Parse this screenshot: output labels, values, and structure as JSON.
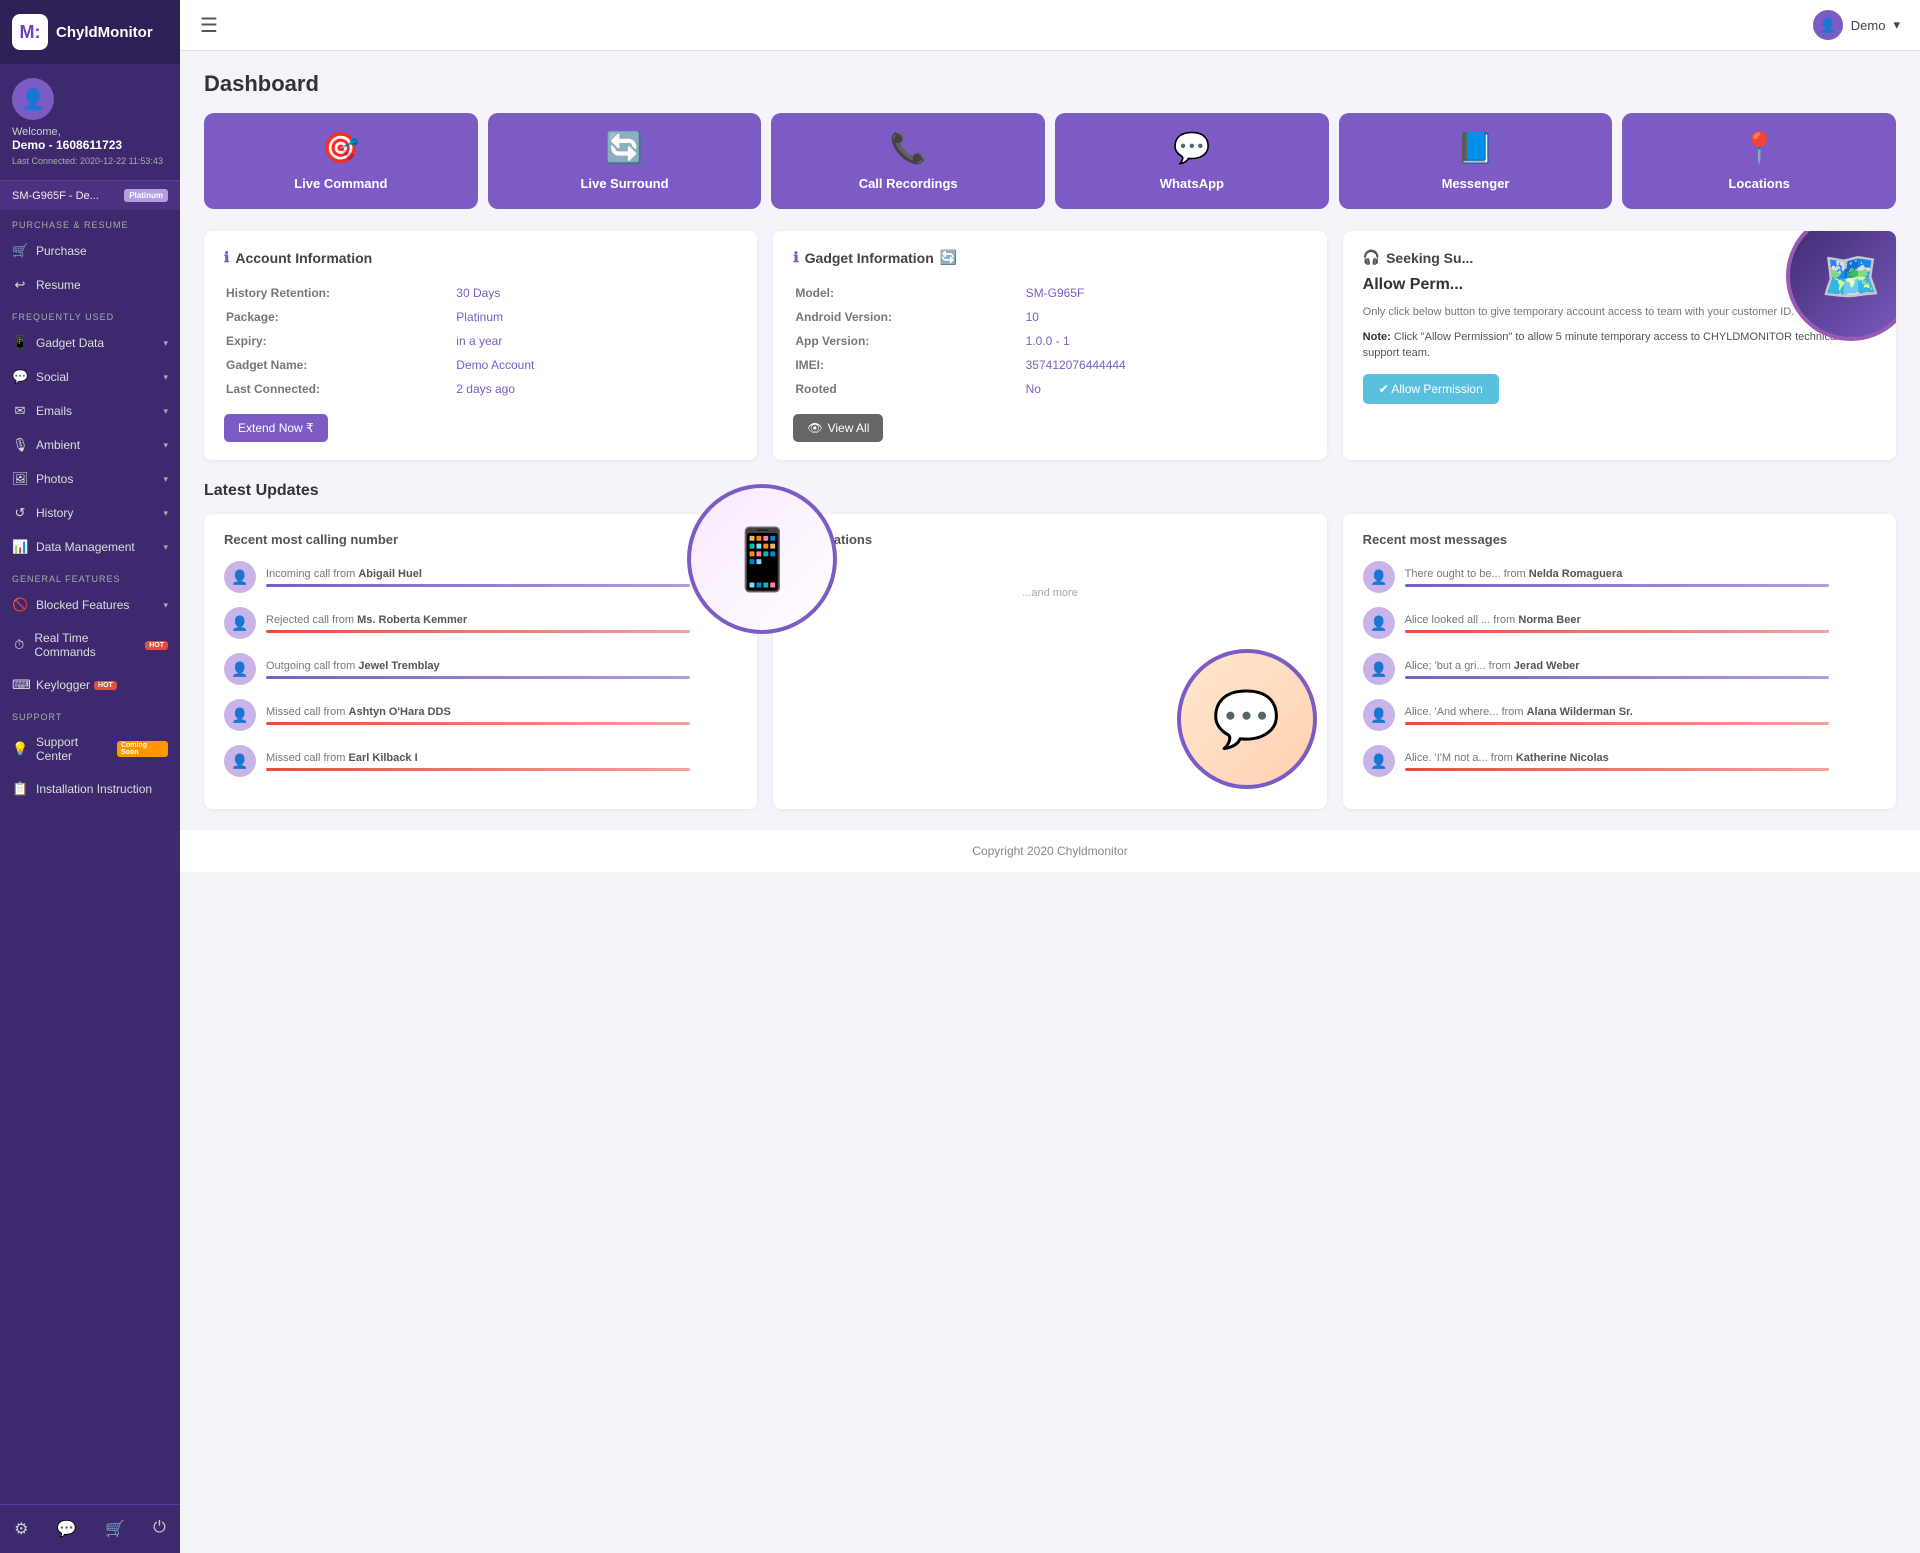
{
  "app": {
    "name": "ChyldMonitor",
    "logo_letter": "M:"
  },
  "topbar": {
    "menu_icon": "☰",
    "user_label": "Demo",
    "user_dropdown": "▾"
  },
  "sidebar": {
    "user": {
      "welcome": "Welcome,",
      "name": "Demo - 1608611723",
      "last_connected": "Last Connected: 2020-12-22 11:53:43"
    },
    "device": {
      "name": "SM-G965F - De...",
      "badge": "Platinum"
    },
    "sections": [
      {
        "title": "PURCHASE & RESUME",
        "items": [
          {
            "label": "Purchase",
            "icon": "🛒"
          },
          {
            "label": "Resume",
            "icon": "↩"
          }
        ]
      },
      {
        "title": "FREQUENTLY USED",
        "items": [
          {
            "label": "Gadget Data",
            "icon": "📱",
            "has_arrow": true
          },
          {
            "label": "Social",
            "icon": "💬",
            "has_arrow": true
          },
          {
            "label": "Emails",
            "icon": "✉",
            "has_arrow": true
          },
          {
            "label": "Ambient",
            "icon": "🎙",
            "has_arrow": true
          },
          {
            "label": "Photos",
            "icon": "🖼",
            "has_arrow": true
          },
          {
            "label": "History",
            "icon": "↺",
            "has_arrow": true
          },
          {
            "label": "Data Management",
            "icon": "📊",
            "has_arrow": true
          }
        ]
      },
      {
        "title": "GENERAL FEATURES",
        "items": [
          {
            "label": "Blocked Features",
            "icon": "🚫",
            "has_arrow": true
          },
          {
            "label": "Real Time Commands",
            "icon": "⏱",
            "has_arrow": false,
            "badge": "HOT"
          },
          {
            "label": "Keylogger",
            "icon": "⌨",
            "has_arrow": false,
            "badge": "HOT"
          }
        ]
      },
      {
        "title": "SUPPORT",
        "items": [
          {
            "label": "Support Center",
            "icon": "💡",
            "has_arrow": false,
            "badge": "COMING_SOON"
          },
          {
            "label": "Installation Instruction",
            "icon": "📋",
            "has_arrow": false
          }
        ]
      }
    ],
    "footer_icons": [
      "⚙",
      "💬",
      "🛒",
      "⏻"
    ]
  },
  "page": {
    "title": "Dashboard"
  },
  "quick_cards": [
    {
      "label": "Live Command",
      "icon": "🎯"
    },
    {
      "label": "Live Surround",
      "icon": "🔄"
    },
    {
      "label": "Call Recordings",
      "icon": "📞"
    },
    {
      "label": "WhatsApp",
      "icon": "💬"
    },
    {
      "label": "Messenger",
      "icon": "📘"
    },
    {
      "label": "Locations",
      "icon": "📍"
    }
  ],
  "account_info": {
    "title": "Account Information",
    "info_icon": "ℹ",
    "rows": [
      {
        "label": "History Retention:",
        "value": "30 Days"
      },
      {
        "label": "Package:",
        "value": "Platinum"
      },
      {
        "label": "Expiry:",
        "value": "in a year"
      },
      {
        "label": "Gadget Name:",
        "value": "Demo Account"
      },
      {
        "label": "Last Connected:",
        "value": "2 days ago"
      }
    ],
    "button": "Extend Now ₹"
  },
  "gadget_info": {
    "title": "Gadget Information",
    "info_icon": "ℹ",
    "refresh_icon": "🔄",
    "rows": [
      {
        "label": "Model:",
        "value": "SM-G965F"
      },
      {
        "label": "Android Version:",
        "value": "10"
      },
      {
        "label": "App Version:",
        "value": "1.0.0 - 1"
      },
      {
        "label": "IMEI:",
        "value": "357412076444444"
      },
      {
        "label": "Rooted",
        "value": "No"
      }
    ],
    "button": "👁 View All"
  },
  "permission": {
    "title": "Seeking Su...",
    "title_icon": "🎧",
    "heading": "Allow Perm...",
    "description": "Only click below button to give temporary account access to team with your customer ID.",
    "note_label": "Note:",
    "note_text": "Click \"Allow Permission\" to allow 5 minute temporary access to CHYLDMONITOR technical support team.",
    "button": "✔ Allow Permission"
  },
  "latest_updates": {
    "section_title": "Latest Updates",
    "calls": {
      "title": "Recent most calling number",
      "items": [
        {
          "text": "Incoming call from",
          "name": "Abigail Huel",
          "bar_color": "bar-purple"
        },
        {
          "text": "Rejected call from",
          "name": "Ms. Roberta Kemmer",
          "bar_color": "bar-red"
        },
        {
          "text": "Outgoing call from",
          "name": "Jewel Tremblay",
          "bar_color": "bar-purple"
        },
        {
          "text": "Missed call from",
          "name": "Ashtyn O'Hara DDS",
          "bar_color": "bar-red"
        },
        {
          "text": "Missed call from",
          "name": "Earl Kilback I",
          "bar_color": "bar-red"
        }
      ]
    },
    "notifications": {
      "title": "Notifications",
      "placeholder": "...and more"
    },
    "messages": {
      "title": "Recent most messages",
      "items": [
        {
          "text": "There ought to be... from",
          "name": "Nelda Romaguera",
          "bar_color": "bar-purple"
        },
        {
          "text": "Alice looked all ... from",
          "name": "Norma Beer",
          "bar_color": "bar-red"
        },
        {
          "text": "Alice; 'but a gri... from",
          "name": "Jerad Weber",
          "bar_color": "bar-purple"
        },
        {
          "text": "Alice. 'And where... from",
          "name": "Alana Wilderman Sr.",
          "bar_color": "bar-red"
        },
        {
          "text": "Alice. 'I'M not a... from",
          "name": "Katherine Nicolas",
          "bar_color": "bar-red"
        }
      ]
    }
  },
  "footer": {
    "text": "Copyright 2020 Chyldmonitor"
  }
}
